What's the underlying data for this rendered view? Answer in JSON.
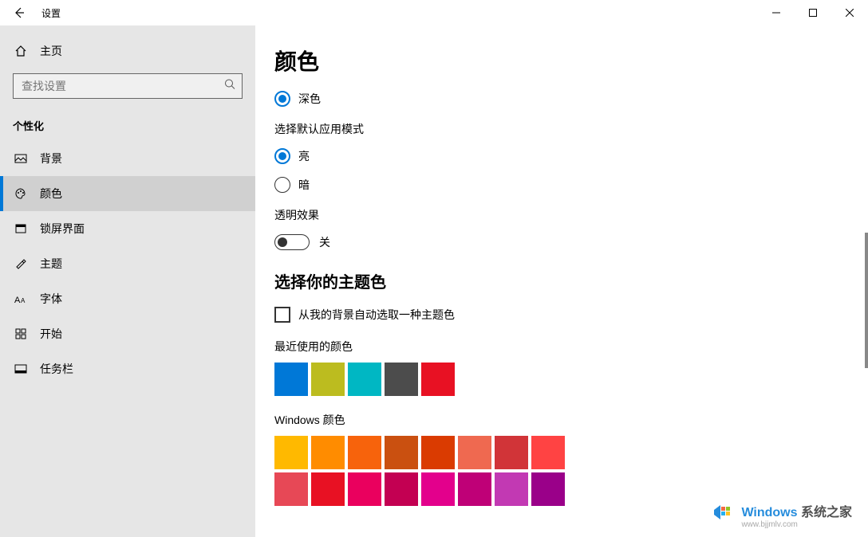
{
  "titlebar": {
    "title": "设置"
  },
  "sidebar": {
    "home": "主页",
    "search_placeholder": "查找设置",
    "section": "个性化",
    "items": [
      {
        "id": "background",
        "label": "背景"
      },
      {
        "id": "colors",
        "label": "颜色",
        "active": true
      },
      {
        "id": "lockscreen",
        "label": "锁屏界面"
      },
      {
        "id": "themes",
        "label": "主题"
      },
      {
        "id": "fonts",
        "label": "字体"
      },
      {
        "id": "start",
        "label": "开始"
      },
      {
        "id": "taskbar",
        "label": "任务栏"
      }
    ]
  },
  "content": {
    "title": "颜色",
    "dark_option": "深色",
    "app_mode_heading": "选择默认应用模式",
    "light_option": "亮",
    "dark2_option": "暗",
    "transparency_heading": "透明效果",
    "transparency_state": "关",
    "accent_heading": "选择你的主题色",
    "auto_pick_label": "从我的背景自动选取一种主题色",
    "recent_label": "最近使用的颜色",
    "recent_colors": [
      "#0078d7",
      "#bcbc1f",
      "#00b7c3",
      "#4c4c4c",
      "#e81123"
    ],
    "windows_label": "Windows 颜色",
    "windows_colors": [
      "#ffb900",
      "#ff8c00",
      "#f7630c",
      "#ca5010",
      "#da3b01",
      "#ef6950",
      "#d13438",
      "#ff4343",
      "#e74856",
      "#e81123",
      "#ea005e",
      "#c30052",
      "#e3008c",
      "#bf0077",
      "#c239b3",
      "#9a0089"
    ]
  },
  "watermark": {
    "title": "Windows 系统之家",
    "sub": "www.bjjmlv.com"
  }
}
